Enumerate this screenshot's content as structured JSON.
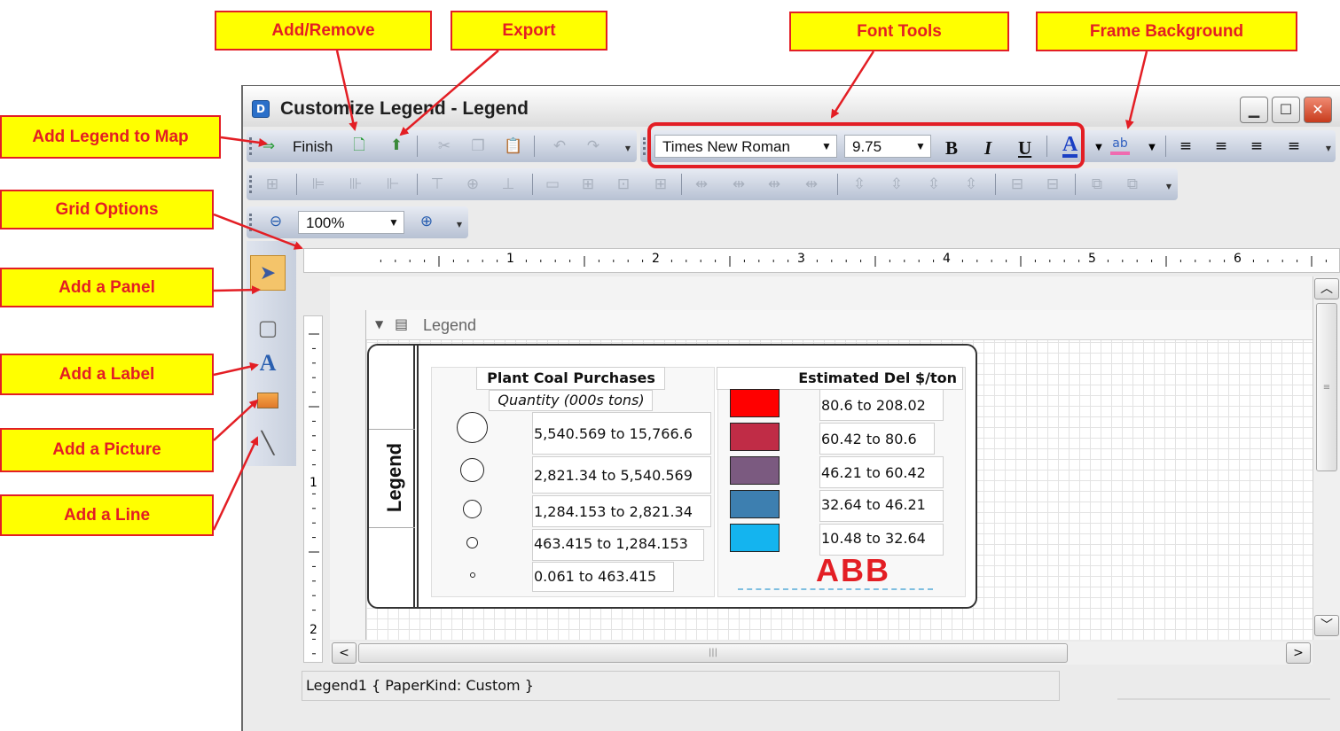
{
  "annotations": {
    "add_remove": "Add/Remove",
    "export": "Export",
    "font_tools": "Font Tools",
    "frame_background": "Frame Background",
    "add_legend_to_map": "Add Legend to Map",
    "grid_options": "Grid Options",
    "add_panel": "Add a Panel",
    "add_label": "Add a Label",
    "add_picture": "Add a Picture",
    "add_line": "Add a Line"
  },
  "window": {
    "title": "Customize Legend - Legend",
    "app_icon": "legend-app-icon",
    "controls": [
      "minimize-icon",
      "maximize-icon",
      "close-icon"
    ]
  },
  "toolbar": {
    "finish_label": "Finish",
    "font_family": "Times New Roman",
    "font_size": "9.75",
    "bold": "B",
    "italic": "I",
    "underline": "U",
    "font_color_glyph": "A",
    "highlight_color": "#f06bb0",
    "font_color": "#1a3fc4"
  },
  "zoom": {
    "value": "100%"
  },
  "ruler": {
    "h_numbers": [
      "1",
      "2",
      "3",
      "4",
      "5",
      "6"
    ],
    "v_numbers": [
      "1",
      "2"
    ]
  },
  "band": {
    "label": "Legend"
  },
  "legend": {
    "side_title": "Legend",
    "plant_header": "Plant Coal Purchases",
    "plant_subheader": "Quantity (000s tons)",
    "plant_rows": [
      "5,540.569 to 15,766.6",
      "2,821.34 to 5,540.569",
      "1,284.153 to 2,821.34",
      "463.415 to 1,284.153",
      "0.061 to 463.415"
    ],
    "price_header": "Estimated Del $/ton",
    "price_rows": [
      {
        "label": "80.6 to 208.02",
        "color": "#ff0000"
      },
      {
        "label": "60.42 to 80.6",
        "color": "#c02c46"
      },
      {
        "label": "46.21 to 60.42",
        "color": "#7b5a80"
      },
      {
        "label": "32.64 to 46.21",
        "color": "#3d7fb0"
      },
      {
        "label": "10.48 to 32.64",
        "color": "#14b4ef"
      }
    ],
    "logo": "ABB",
    "logo_color": "#e31e24"
  },
  "status": {
    "text": "Legend1 { PaperKind: Custom }"
  },
  "colors": {
    "callout_fill": "#ffff00",
    "callout_text": "#e31e24",
    "highlight_border": "#e31e24"
  }
}
